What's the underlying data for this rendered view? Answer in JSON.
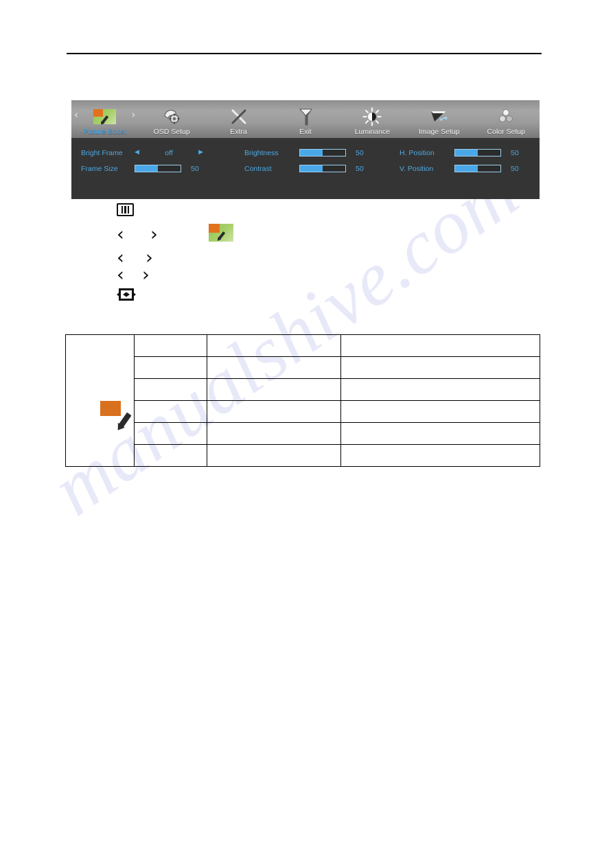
{
  "osd": {
    "tabs": [
      {
        "label": "Picture Boost",
        "icon": "picture-boost-thumbnail-icon",
        "active": true,
        "left_arrow": "‹",
        "right_arrow": "›"
      },
      {
        "label": "OSD Setup",
        "icon": "osd-setup-icon",
        "active": false
      },
      {
        "label": "Extra",
        "icon": "extra-icon",
        "active": false
      },
      {
        "label": "Exit",
        "icon": "exit-icon",
        "active": false
      },
      {
        "label": "Luminance",
        "icon": "luminance-icon",
        "active": false
      },
      {
        "label": "Image Setup",
        "icon": "image-setup-icon",
        "active": false
      },
      {
        "label": "Color Setup",
        "icon": "color-setup-icon",
        "active": false
      }
    ],
    "columns": [
      {
        "rows": [
          {
            "label": "Bright Frame",
            "type": "spinner",
            "value": "off",
            "left_arrow": "◀",
            "right_arrow": "▶"
          },
          {
            "label": "Frame Size",
            "type": "slider",
            "value": "50",
            "fill_percent": 50
          }
        ]
      },
      {
        "rows": [
          {
            "label": "Brightness",
            "type": "slider",
            "value": "50",
            "fill_percent": 50
          },
          {
            "label": "Contrast",
            "type": "slider",
            "value": "50",
            "fill_percent": 50
          }
        ]
      },
      {
        "rows": [
          {
            "label": "H. Position",
            "type": "slider",
            "value": "50",
            "fill_percent": 50
          },
          {
            "label": "V. Position",
            "type": "slider",
            "value": "50",
            "fill_percent": 50
          }
        ]
      }
    ],
    "colors": {
      "accent_blue": "#4fa8e0",
      "slider_fill": "#4aa8e8",
      "panel_background": "#343434",
      "tab_bar_top": "#a6a6a6",
      "thumb_orange": "#e2721d",
      "thumb_green": "#93c356"
    }
  },
  "steps": [
    {
      "name": "menu-button-step",
      "icon": "menu-button-icon"
    },
    {
      "name": "navigate-step-1",
      "icon_left": "chevron-left-icon",
      "icon_right": "chevron-right-icon",
      "thumbnail": "picture-boost-thumbnail-icon"
    },
    {
      "name": "navigate-step-2",
      "icon_left": "chevron-left-icon",
      "icon_right": "chevron-right-icon"
    },
    {
      "name": "navigate-step-3",
      "icon_left": "chevron-left-icon",
      "icon_right": "chevron-right-icon"
    },
    {
      "name": "auto-button-step",
      "icon": "auto-exit-button-icon"
    }
  ],
  "table": {
    "icon_cell": "picture-boost-thumbnail-icon",
    "rows": [
      {
        "item": "",
        "desc": "",
        "note": ""
      },
      {
        "item": "",
        "desc": "",
        "note": ""
      },
      {
        "item": "",
        "desc": "",
        "note": ""
      },
      {
        "item": "",
        "desc": "",
        "note": ""
      },
      {
        "item": "",
        "desc": "",
        "note": ""
      },
      {
        "item": "",
        "desc": "",
        "note": ""
      }
    ]
  },
  "watermark": {
    "text": "manualshive.com"
  }
}
